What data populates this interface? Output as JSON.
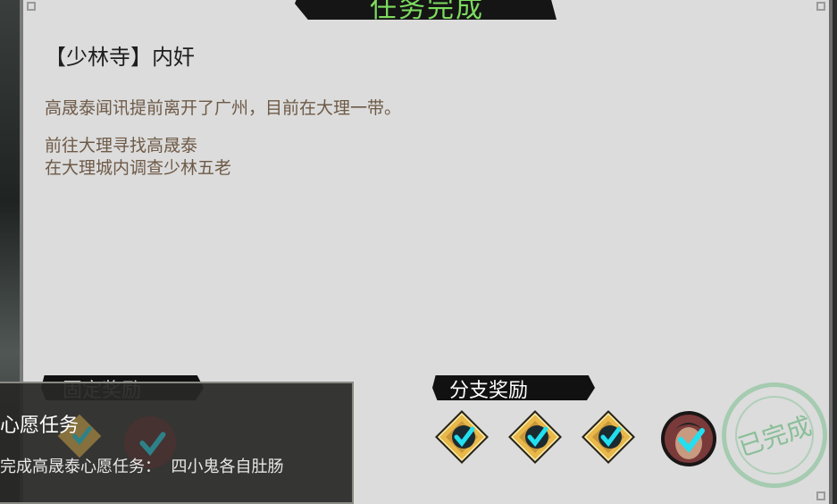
{
  "header": {
    "title": "任务完成"
  },
  "quest": {
    "name": "【少林寺】内奸",
    "description": "高晟泰闻讯提前离开了广州，目前在大理一带。",
    "objectives": [
      "前往大理寻找高晟泰",
      "在大理城内调查少林五老"
    ]
  },
  "rewards": {
    "fixed_label": "固定奖励",
    "branch_label": "分支奖励",
    "branch_items": [
      {
        "icon": "gold-diamond-checked-icon"
      },
      {
        "icon": "gold-diamond-checked-icon"
      },
      {
        "icon": "gold-diamond-checked-icon"
      },
      {
        "icon": "character-portrait-checked-icon"
      }
    ]
  },
  "stamp": {
    "text": "已完成"
  },
  "popup": {
    "title": "心愿任务",
    "description": "完成高晟泰心愿任务：  四小鬼各自肚肠"
  },
  "colors": {
    "title_green": "#7ddc5f",
    "panel_bg": "#dcdcdc",
    "text_brown": "#6e5a47",
    "check_cyan": "#22e0f0",
    "gold": "#e8b84a"
  }
}
